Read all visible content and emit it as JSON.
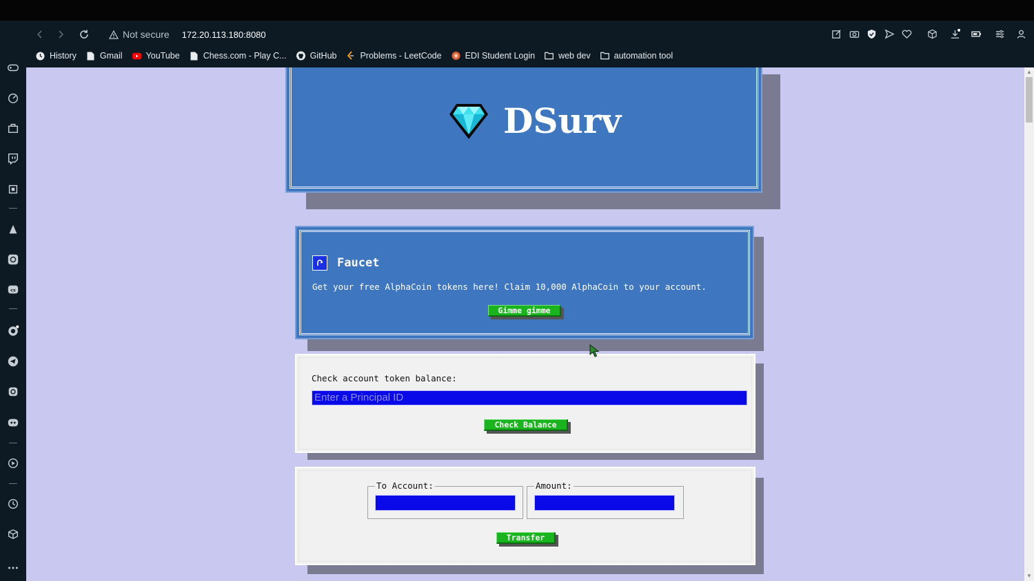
{
  "browser": {
    "security_label": "Not secure",
    "url": "172.20.113.180:8080",
    "bookmarks": [
      {
        "label": "History",
        "icon": "history-icon"
      },
      {
        "label": "Gmail",
        "icon": "page-icon"
      },
      {
        "label": "YouTube",
        "icon": "youtube-icon"
      },
      {
        "label": "Chess.com - Play C...",
        "icon": "page-icon"
      },
      {
        "label": "GitHub",
        "icon": "github-icon"
      },
      {
        "label": "Problems - LeetCode",
        "icon": "leetcode-icon"
      },
      {
        "label": "EDI Student Login",
        "icon": "globe-icon"
      },
      {
        "label": "web dev",
        "icon": "folder-icon"
      },
      {
        "label": "automation tool",
        "icon": "folder-icon"
      }
    ]
  },
  "header": {
    "brand": "DSurv",
    "logo_icon": "diamond-icon"
  },
  "faucet": {
    "title": "Faucet",
    "icon": "faucet-icon",
    "description": "Get your free AlphaCoin tokens here! Claim 10,000 AlphaCoin to your account.",
    "button_label": "Gimme gimme"
  },
  "balance": {
    "label": "Check account token balance:",
    "input_placeholder": "Enter a Principal ID",
    "input_value": "",
    "button_label": "Check Balance"
  },
  "transfer": {
    "to_account_label": "To Account:",
    "to_account_value": "",
    "amount_label": "Amount:",
    "amount_value": "",
    "button_label": "Transfer"
  },
  "colors": {
    "page_bg": "#c8c8f0",
    "card_blue": "#3f76c0",
    "button_green": "#19b41e",
    "input_blue": "#0a0ae8"
  }
}
